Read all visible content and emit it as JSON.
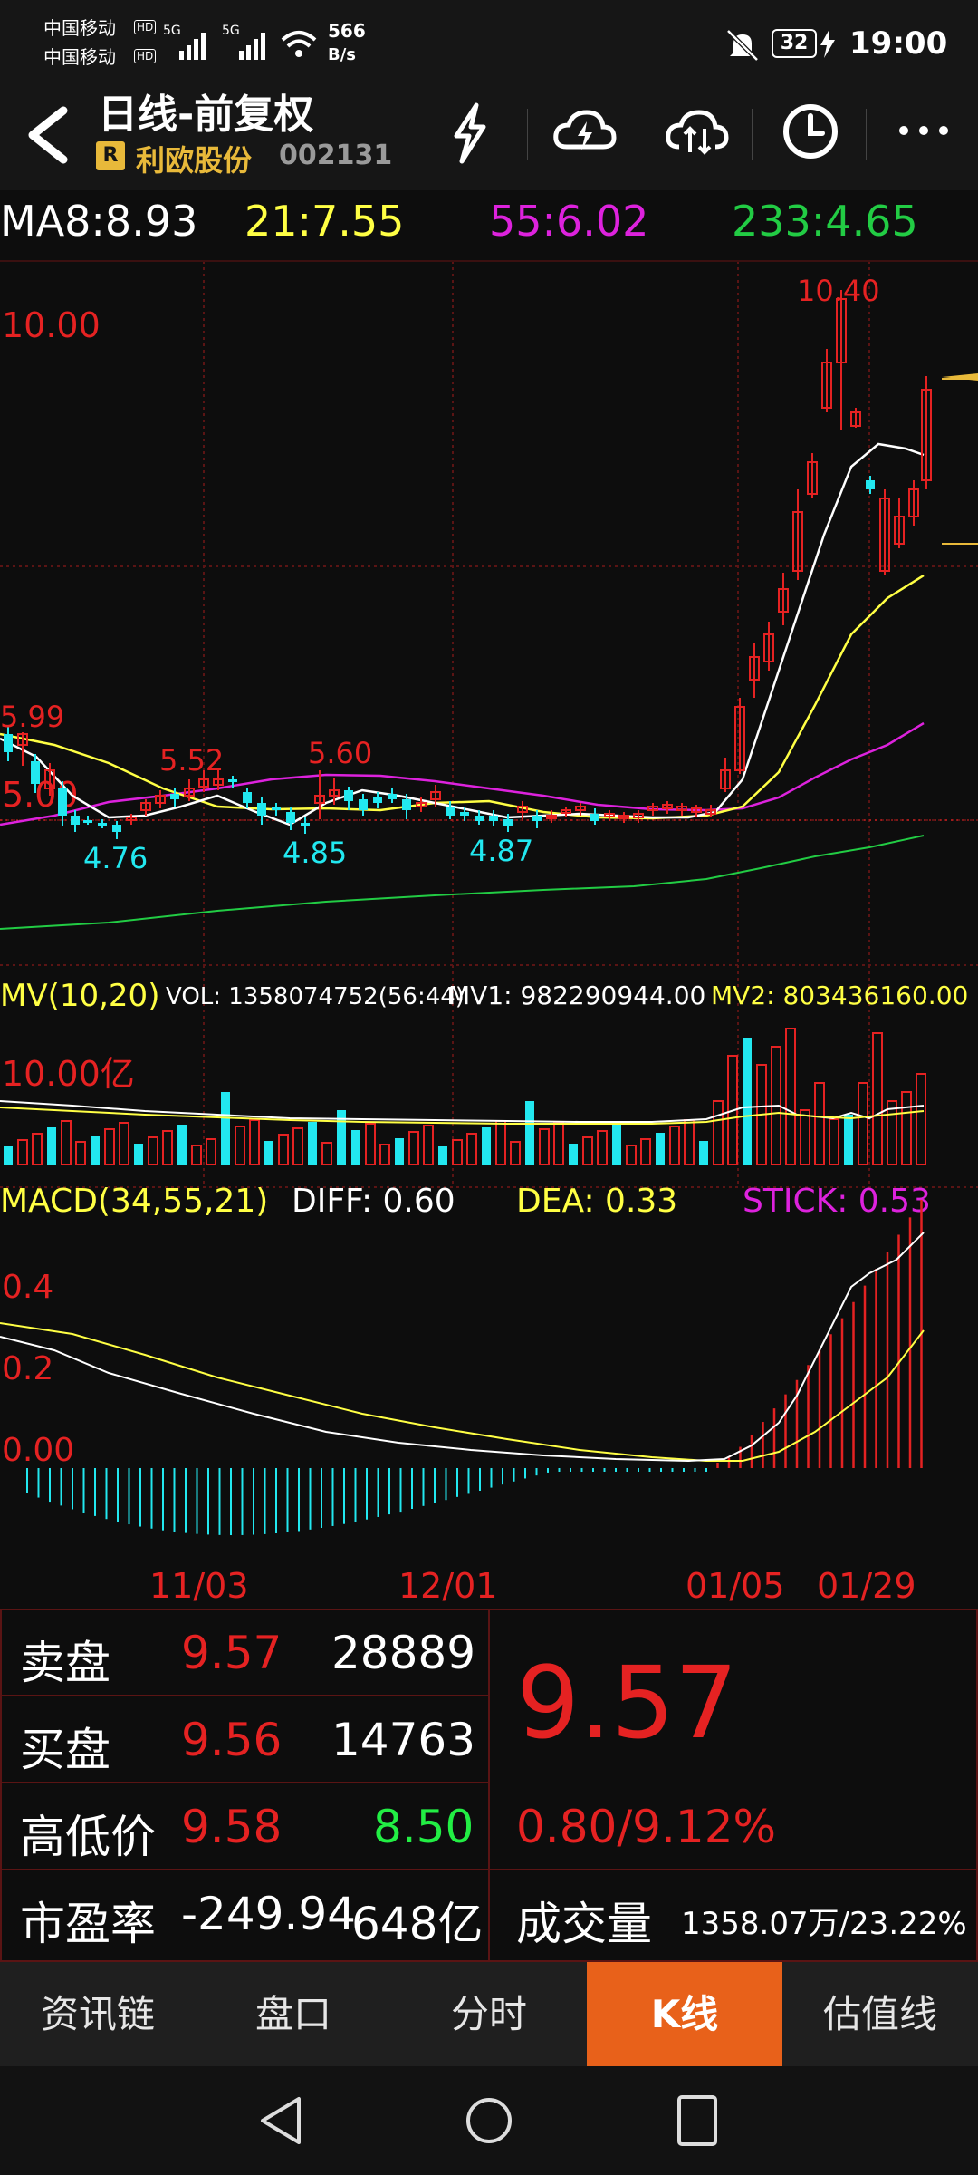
{
  "status": {
    "carrier1": "中国移动",
    "carrier2": "中国移动",
    "hd": "HD",
    "net1": "5G",
    "net2": "5G",
    "speed": "566",
    "speed_unit": "B/s",
    "battery": "32",
    "time": "19:00"
  },
  "header": {
    "title": "日线-前复权",
    "badge": "R",
    "stock_name": "利欧股份",
    "stock_code": "002131"
  },
  "ma": {
    "ma8": "MA8:8.93",
    "ma21": "21:7.55",
    "ma55": "55:6.02",
    "ma233": "233:4.65"
  },
  "price_chart": {
    "level_label": "10.00",
    "level_label2": "5.00",
    "annotations": [
      "10.40",
      "5.99",
      "5.52",
      "5.60",
      "4.76",
      "4.85",
      "4.87"
    ]
  },
  "volume_header": {
    "title": "MV(10,20)",
    "vol": "VOL: 1358074752(56:44)",
    "mv1": "MV1: 982290944.00",
    "mv2": "MV2: 803436160.00",
    "level_label": "10.00亿"
  },
  "macd_header": {
    "title": "MACD(34,55,21)",
    "diff": "DIFF: 0.60",
    "dea": "DEA: 0.33",
    "stick": "STICK: 0.53",
    "y_labels": [
      "0.4",
      "0.2",
      "0.00"
    ]
  },
  "dates": [
    "11/03",
    "12/01",
    "01/05",
    "01/29"
  ],
  "quote": {
    "sell_label": "卖盘",
    "sell_price": "9.57",
    "sell_vol": "28889",
    "buy_label": "买盘",
    "buy_price": "9.56",
    "buy_vol": "14763",
    "hl_label": "高低价",
    "high": "9.58",
    "low": "8.50",
    "pe_label": "市盈率",
    "pe": "-249.94",
    "mcap": "648亿",
    "price": "9.57",
    "change": "0.80/9.12%",
    "turnover_label": "成交量",
    "turnover": "1358.07万/23.22%"
  },
  "tabs": [
    "资讯链",
    "盘口",
    "分时",
    "K线",
    "估值线"
  ],
  "colors": {
    "up": "#e52222",
    "down": "#22e8f0",
    "ma8": "#ffffff",
    "ma21": "#ffff44",
    "ma55": "#dd22dd",
    "ma233": "#22cc44",
    "accent": "#e8611a"
  }
}
